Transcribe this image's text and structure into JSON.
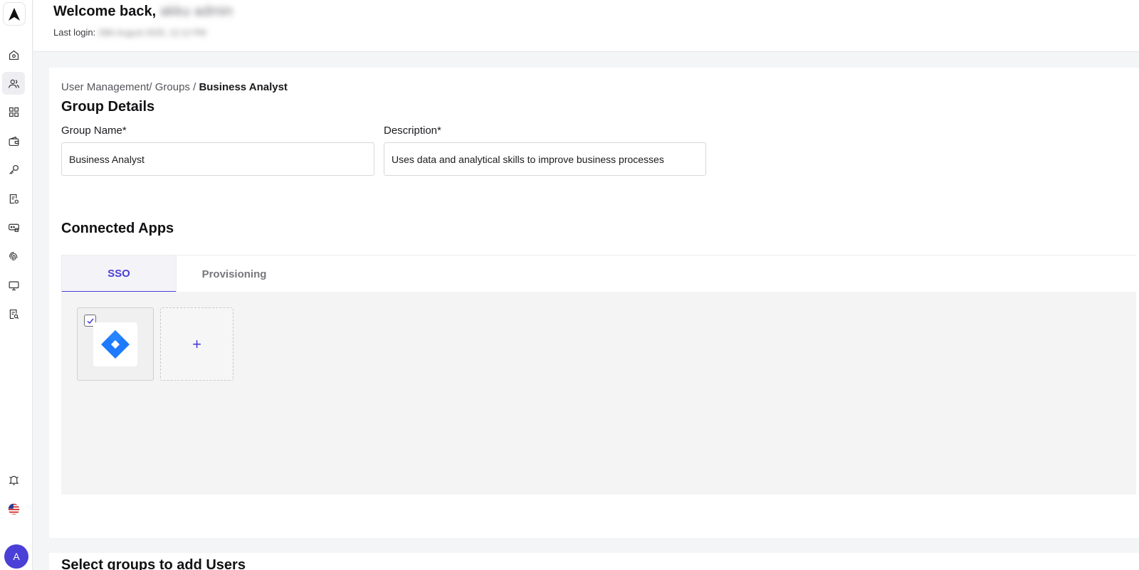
{
  "sidebar": {
    "logo_icon": "arrow-logo-icon",
    "items": [
      {
        "name": "home",
        "icon": "home-icon",
        "active": false
      },
      {
        "name": "users",
        "icon": "users-icon",
        "active": true
      },
      {
        "name": "apps",
        "icon": "grid-icon",
        "active": false
      },
      {
        "name": "wallet",
        "icon": "wallet-icon",
        "active": false
      },
      {
        "name": "keys",
        "icon": "key-icon",
        "active": false
      },
      {
        "name": "policies",
        "icon": "document-settings-icon",
        "active": false
      },
      {
        "name": "passwords",
        "icon": "password-icon",
        "active": false
      },
      {
        "name": "biometrics",
        "icon": "fingerprint-icon",
        "active": false
      },
      {
        "name": "devices",
        "icon": "monitor-icon",
        "active": false
      },
      {
        "name": "reports",
        "icon": "document-search-icon",
        "active": false
      }
    ],
    "bottom": {
      "notifications_icon": "bell-icon",
      "language_icon": "us-flag-icon",
      "avatar_initial": "A"
    },
    "accent_color": "#4a3fd6"
  },
  "header": {
    "welcome_prefix": "Welcome back,",
    "user_name": "akku admin",
    "last_login_label": "Last login:",
    "last_login_value": "28th August 2025, 12:12 PM"
  },
  "group_details": {
    "breadcrumb_parent": "User Management/ Groups /",
    "breadcrumb_current": "Business Analyst",
    "title": "Group Details",
    "group_name_label": "Group Name*",
    "group_name_value": "Business Analyst",
    "description_label": "Description*",
    "description_value": "Uses data and analytical skills to improve business processes"
  },
  "connected_apps": {
    "title": "Connected Apps",
    "tabs": [
      {
        "label": "SSO",
        "active": true
      },
      {
        "label": "Provisioning",
        "active": false
      }
    ],
    "apps": [
      {
        "icon": "jira-icon",
        "checked": true
      }
    ],
    "add_label": "+"
  },
  "next_section": {
    "title": "Select groups to add Users"
  }
}
